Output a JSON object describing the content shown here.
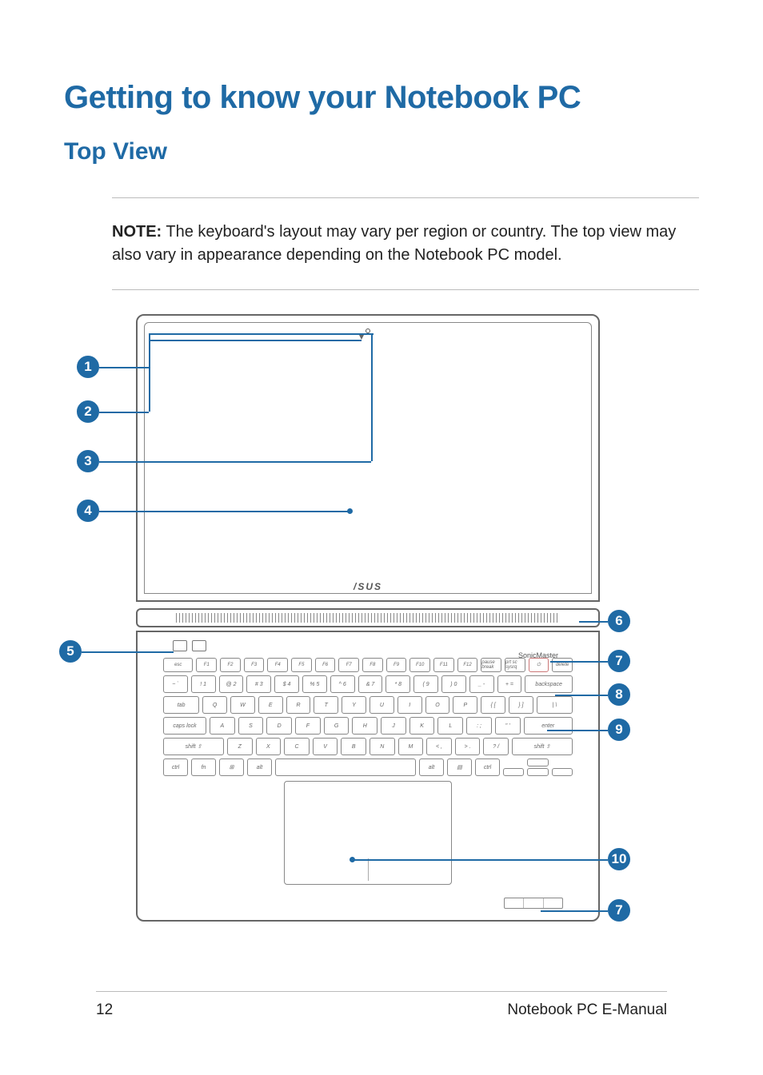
{
  "heading": "Getting to know your Notebook PC",
  "subheading": "Top View",
  "note": {
    "label": "NOTE:",
    "text": " The keyboard's layout may vary per region or country. The top view may also vary in appearance depending on the Notebook PC model."
  },
  "brand": "/SUS",
  "series_label": "SonicMaster",
  "callouts": {
    "c1": "1",
    "c2": "2",
    "c3": "3",
    "c4": "4",
    "c5": "5",
    "c6": "6",
    "c7": "7",
    "c8": "8",
    "c9": "9",
    "c10": "10",
    "c7b": "7"
  },
  "keys": {
    "row_fn": [
      "esc",
      "F1",
      "F2",
      "F3",
      "F4",
      "F5",
      "F6",
      "F7",
      "F8",
      "F9",
      "F10",
      "F11",
      "F12",
      "pause break",
      "prt sc sysrq",
      "⏻",
      "delete"
    ],
    "row_num": [
      "~ `",
      "! 1",
      "@ 2",
      "# 3",
      "$ 4",
      "% 5",
      "^ 6",
      "& 7",
      "* 8",
      "( 9",
      ") 0",
      "_ -",
      "+ =",
      "backspace"
    ],
    "row_q": [
      "tab",
      "Q",
      "W",
      "E",
      "R",
      "T",
      "Y",
      "U",
      "I",
      "O",
      "P",
      "{ [",
      "} ]",
      "| \\"
    ],
    "row_a": [
      "caps lock",
      "A",
      "S",
      "D",
      "F",
      "G",
      "H",
      "J",
      "K",
      "L",
      ": ;",
      "\" '",
      "enter"
    ],
    "row_z": [
      "shift ⇧",
      "Z",
      "X",
      "C",
      "V",
      "B",
      "N",
      "M",
      "< ,",
      "> .",
      "? /",
      "shift ⇧"
    ],
    "row_ctrl": [
      "ctrl",
      "fn",
      "⊞",
      "alt",
      "",
      "alt",
      "▤",
      "ctrl"
    ]
  },
  "footer": {
    "page": "12",
    "title": "Notebook PC E-Manual"
  }
}
